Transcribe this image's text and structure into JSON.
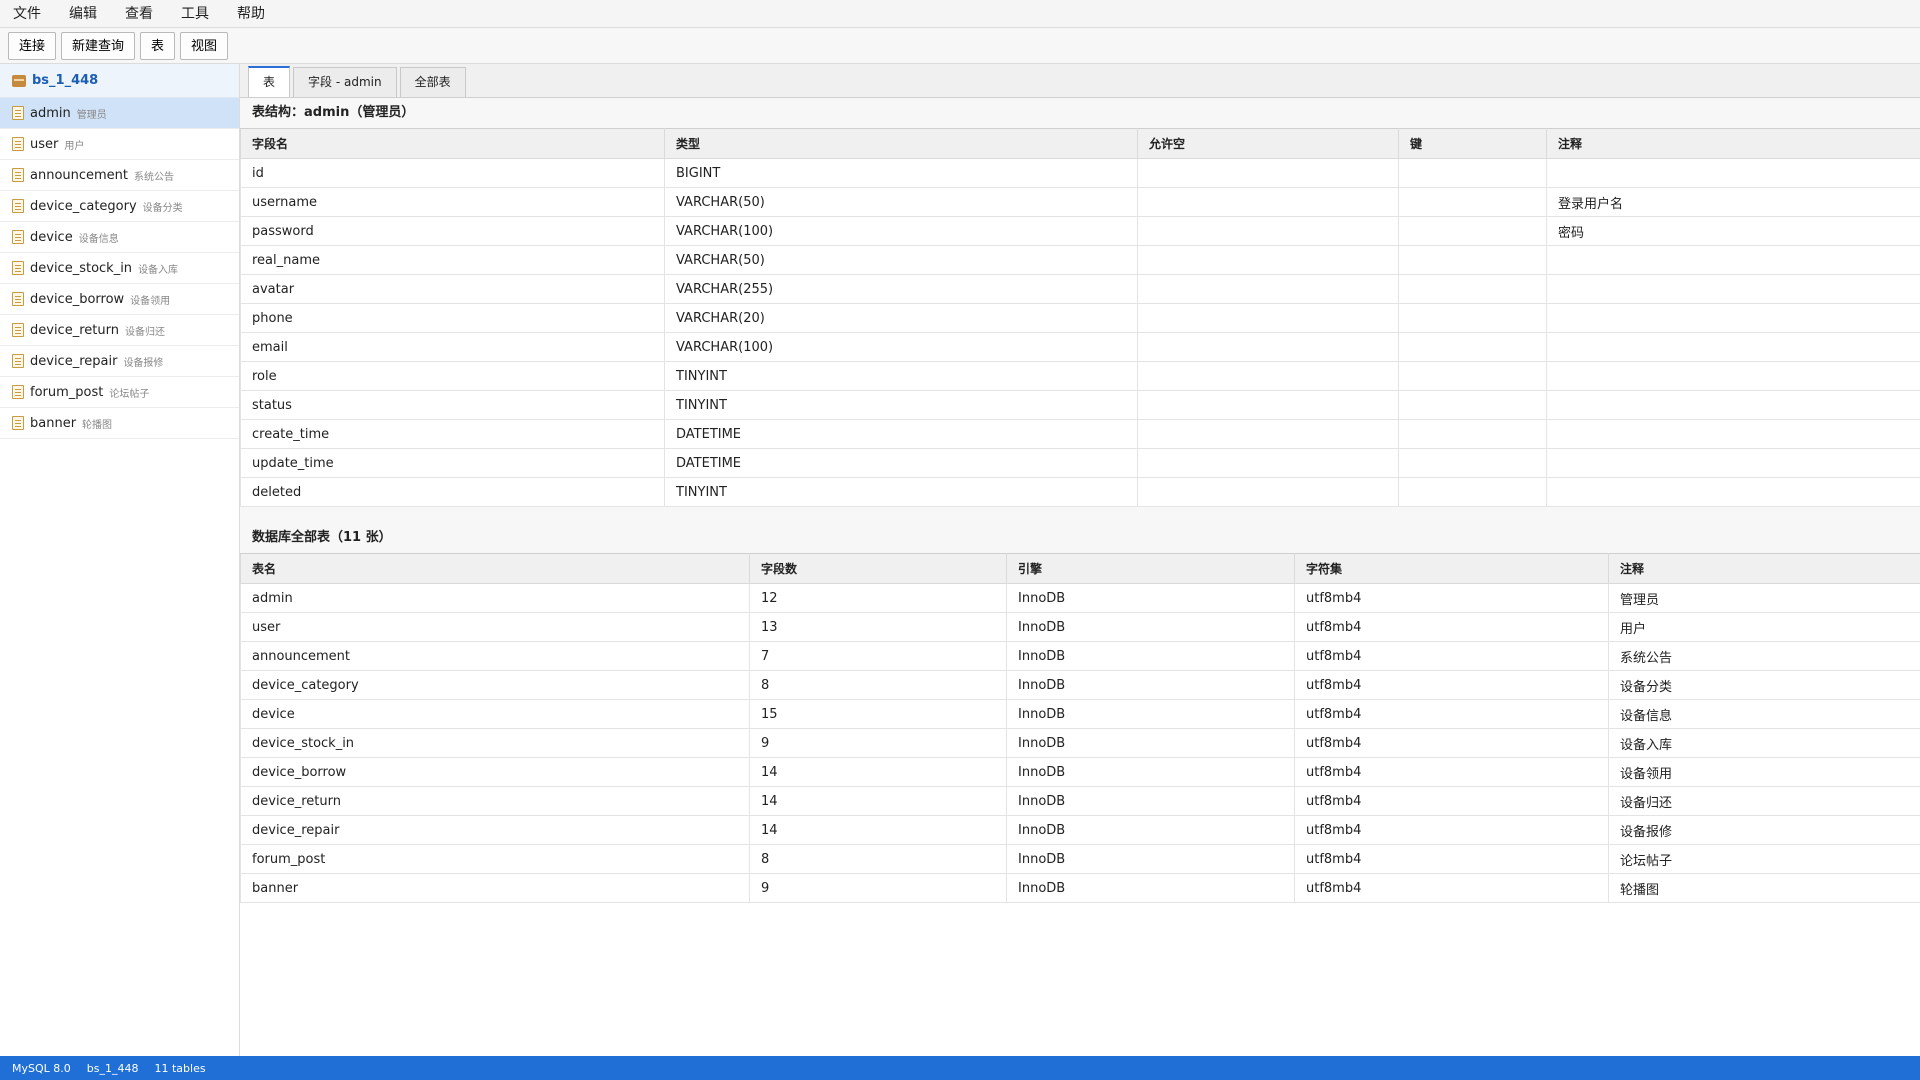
{
  "menu": [
    "文件",
    "编辑",
    "查看",
    "工具",
    "帮助"
  ],
  "toolbar": [
    "连接",
    "新建查询",
    "表",
    "视图"
  ],
  "sidebar": {
    "database": "bs_1_448",
    "tables": [
      {
        "name": "admin",
        "comment": "管理员"
      },
      {
        "name": "user",
        "comment": "用户"
      },
      {
        "name": "announcement",
        "comment": "系统公告"
      },
      {
        "name": "device_category",
        "comment": "设备分类"
      },
      {
        "name": "device",
        "comment": "设备信息"
      },
      {
        "name": "device_stock_in",
        "comment": "设备入库"
      },
      {
        "name": "device_borrow",
        "comment": "设备领用"
      },
      {
        "name": "device_return",
        "comment": "设备归还"
      },
      {
        "name": "device_repair",
        "comment": "设备报修"
      },
      {
        "name": "forum_post",
        "comment": "论坛帖子"
      },
      {
        "name": "banner",
        "comment": "轮播图"
      }
    ]
  },
  "tabs": [
    "表",
    "字段 - admin",
    "全部表"
  ],
  "structure": {
    "title": "表结构：admin（管理员）",
    "headers": [
      "字段名",
      "类型",
      "允许空",
      "键",
      "注释"
    ],
    "rows": [
      [
        "id",
        "BIGINT",
        "",
        "",
        ""
      ],
      [
        "username",
        "VARCHAR(50)",
        "",
        "",
        "登录用户名"
      ],
      [
        "password",
        "VARCHAR(100)",
        "",
        "",
        "密码"
      ],
      [
        "real_name",
        "VARCHAR(50)",
        "",
        "",
        ""
      ],
      [
        "avatar",
        "VARCHAR(255)",
        "",
        "",
        ""
      ],
      [
        "phone",
        "VARCHAR(20)",
        "",
        "",
        ""
      ],
      [
        "email",
        "VARCHAR(100)",
        "",
        "",
        ""
      ],
      [
        "role",
        "TINYINT",
        "",
        "",
        ""
      ],
      [
        "status",
        "TINYINT",
        "",
        "",
        ""
      ],
      [
        "create_time",
        "DATETIME",
        "",
        "",
        ""
      ],
      [
        "update_time",
        "DATETIME",
        "",
        "",
        ""
      ],
      [
        "deleted",
        "TINYINT",
        "",
        "",
        ""
      ]
    ]
  },
  "all_tables": {
    "title": "数据库全部表（11 张）",
    "headers": [
      "表名",
      "字段数",
      "引擎",
      "字符集",
      "注释"
    ],
    "rows": [
      [
        "admin",
        "12",
        "InnoDB",
        "utf8mb4",
        "管理员"
      ],
      [
        "user",
        "13",
        "InnoDB",
        "utf8mb4",
        "用户"
      ],
      [
        "announcement",
        "7",
        "InnoDB",
        "utf8mb4",
        "系统公告"
      ],
      [
        "device_category",
        "8",
        "InnoDB",
        "utf8mb4",
        "设备分类"
      ],
      [
        "device",
        "15",
        "InnoDB",
        "utf8mb4",
        "设备信息"
      ],
      [
        "device_stock_in",
        "9",
        "InnoDB",
        "utf8mb4",
        "设备入库"
      ],
      [
        "device_borrow",
        "14",
        "InnoDB",
        "utf8mb4",
        "设备领用"
      ],
      [
        "device_return",
        "14",
        "InnoDB",
        "utf8mb4",
        "设备归还"
      ],
      [
        "device_repair",
        "14",
        "InnoDB",
        "utf8mb4",
        "设备报修"
      ],
      [
        "forum_post",
        "8",
        "InnoDB",
        "utf8mb4",
        "论坛帖子"
      ],
      [
        "banner",
        "9",
        "InnoDB",
        "utf8mb4",
        "轮播图"
      ]
    ]
  },
  "statusbar": [
    "MySQL 8.0",
    "bs_1_448",
    "11 tables"
  ],
  "colors": {
    "accent": "#1f6fd6",
    "selected_row": "#cfe2f7",
    "db_name": "#1b5fb3"
  },
  "icons": {
    "database": "database-icon",
    "table": "table-icon"
  }
}
